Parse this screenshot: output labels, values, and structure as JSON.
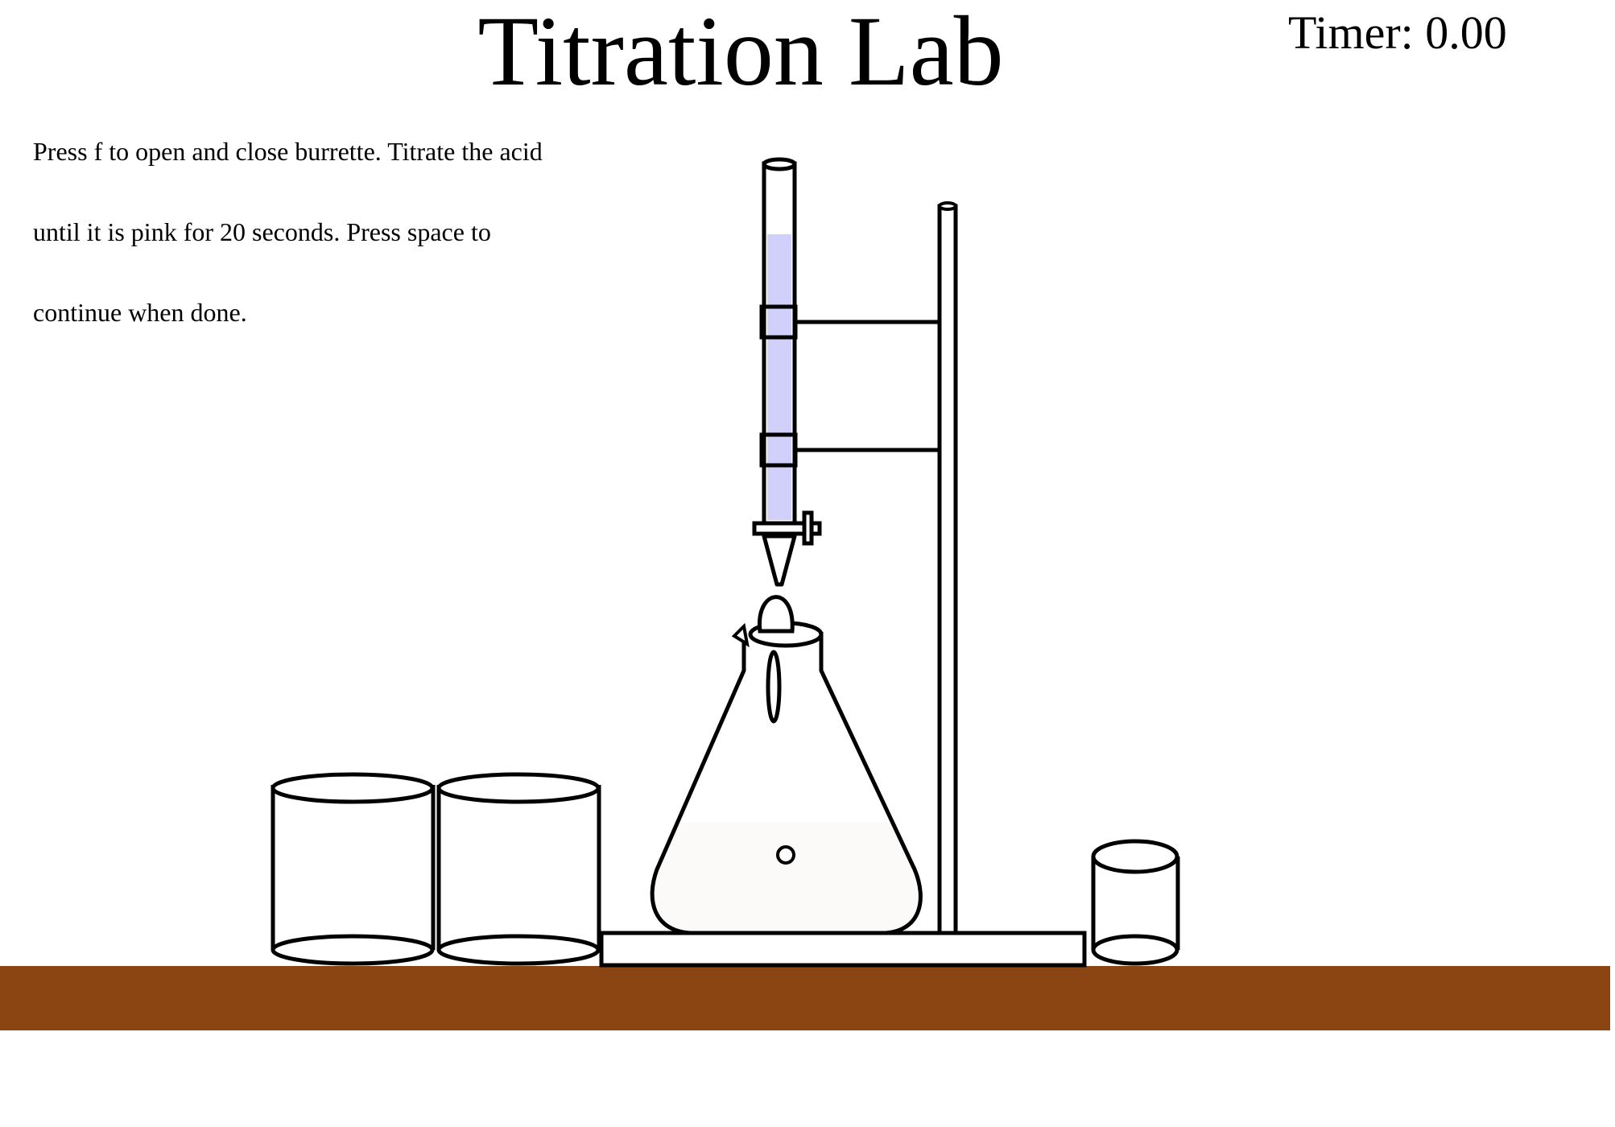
{
  "header": {
    "title": "Titration Lab",
    "timer_label": "Timer:",
    "timer_value": "0.00"
  },
  "instructions": {
    "lines": [
      "Press f to open and close burrette. Titrate the acid",
      "until it is pink for 20 seconds. Press space to",
      "continue when done."
    ]
  },
  "controls": {
    "toggle_burette_key": "f",
    "continue_key": "space"
  },
  "colors": {
    "background": "#ffffff",
    "bench": "#8b4513",
    "burette_solution": "#d0d0fa",
    "flask_solution": "#fcf9f9",
    "outline": "#000000"
  }
}
